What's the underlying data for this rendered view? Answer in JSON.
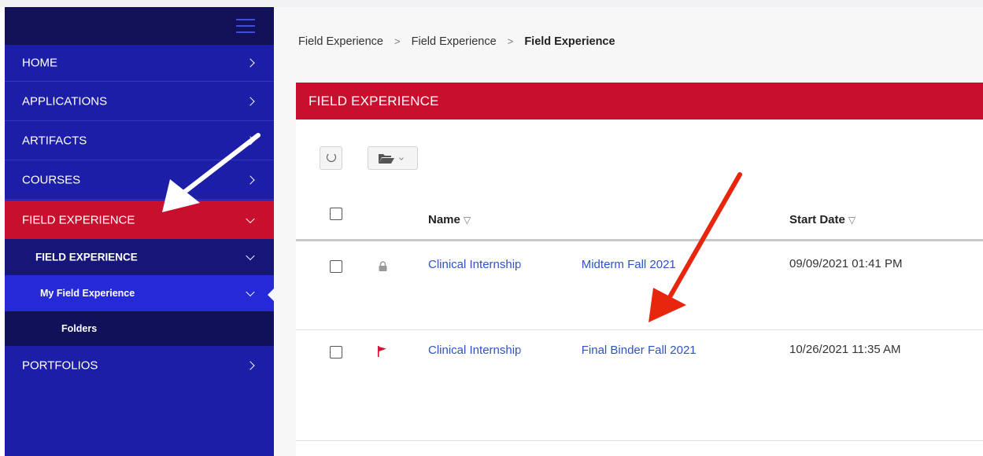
{
  "sidebar": {
    "items": {
      "home": "HOME",
      "applications": "APPLICATIONS",
      "artifacts": "ARTIFACTS",
      "courses": "COURSES",
      "field_experience": "FIELD EXPERIENCE",
      "field_experience_sub": "FIELD EXPERIENCE",
      "my_field_experience": "My Field Experience",
      "folders": "Folders",
      "portfolios": "PORTFOLIOS"
    },
    "colors": {
      "background": "#1c1ea8",
      "active": "#c8102e",
      "header": "#131258"
    }
  },
  "breadcrumb": [
    "Field Experience",
    "Field Experience",
    "Field Experience"
  ],
  "panel": {
    "title": "FIELD EXPERIENCE",
    "columns": {
      "name": "Name",
      "start_date": "Start Date"
    },
    "sort_glyph": "▽",
    "rows": [
      {
        "name_prefix": "Clinical Internship",
        "name_suffix": "Midterm Fall 2021",
        "start_date": "09/09/2021 01:41 PM",
        "status_icon": "lock-icon"
      },
      {
        "name_prefix": "Clinical Internship",
        "name_suffix": "Final Binder Fall 2021",
        "start_date": "10/26/2021 11:35 AM",
        "status_icon": "flag-icon"
      }
    ]
  },
  "toolbar": {
    "refresh_icon": "refresh-icon",
    "folder_icon": "folder-open-icon"
  },
  "annotations": {
    "arrow_colors": [
      "#ffffff",
      "#e8260e"
    ]
  }
}
